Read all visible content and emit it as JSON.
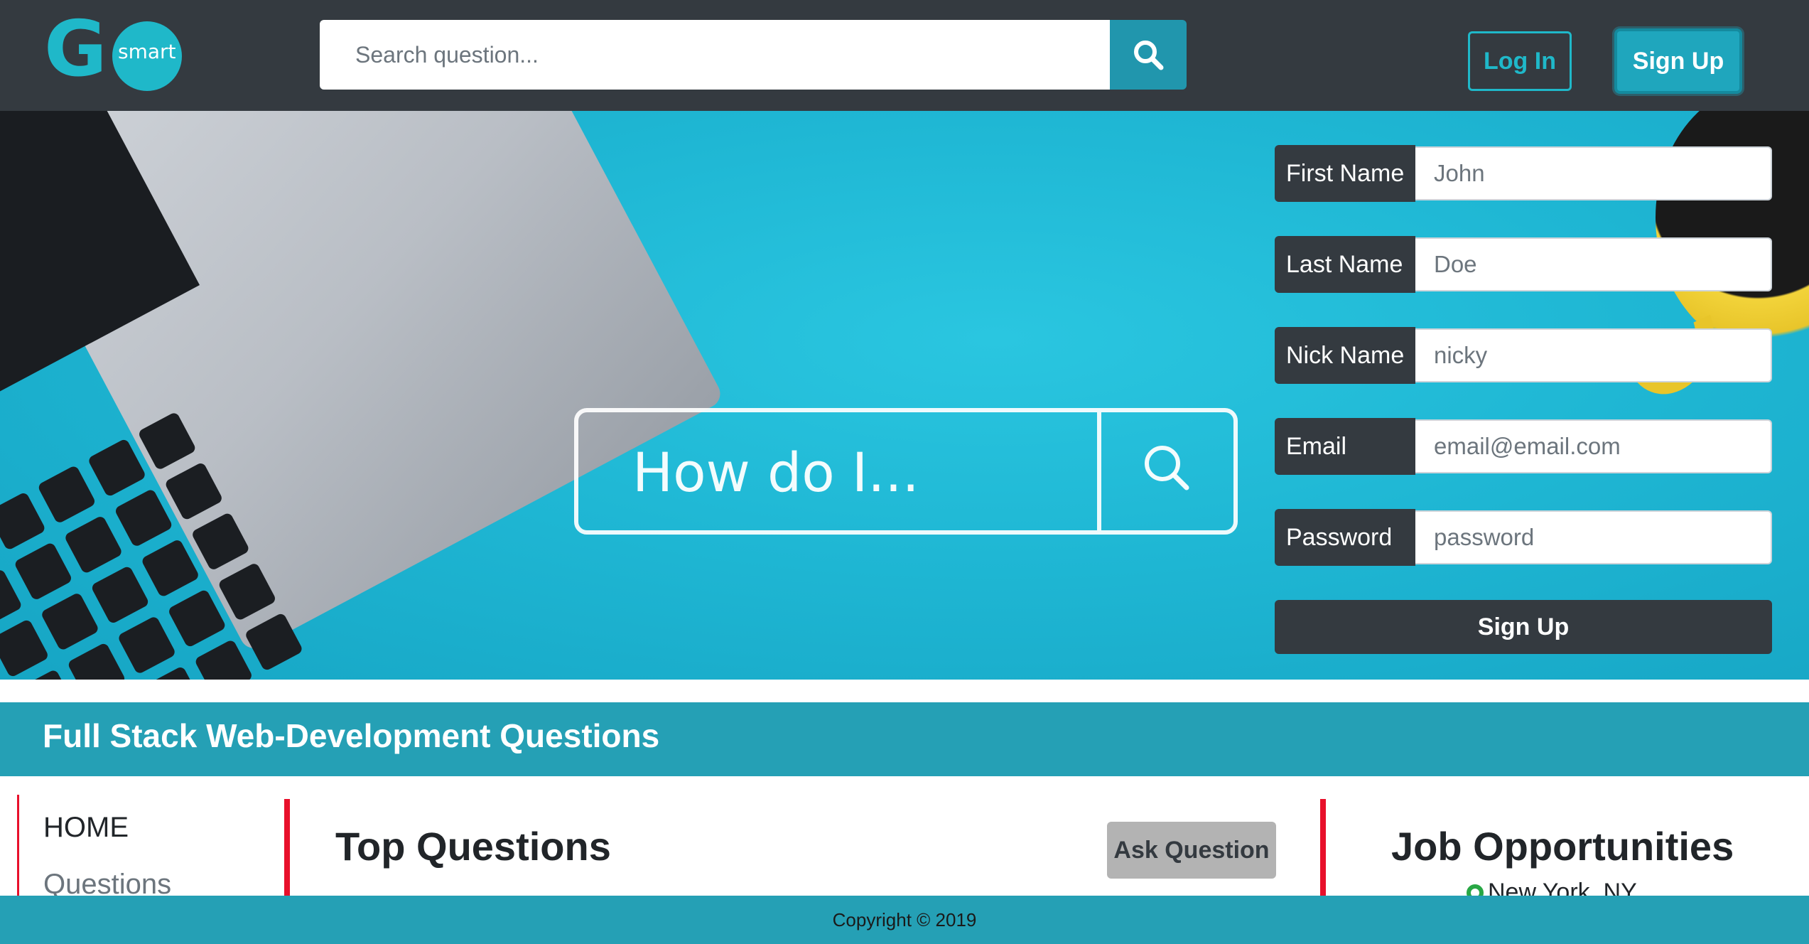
{
  "brand": {
    "logo_big": "G",
    "logo_small": "smart"
  },
  "navbar": {
    "search_placeholder": "Search question...",
    "login_label": "Log In",
    "signup_label": "Sign Up"
  },
  "hero": {
    "search_text": "How do I..."
  },
  "signup_form": {
    "fields": [
      {
        "label": "First Name",
        "placeholder": "John"
      },
      {
        "label": "Last Name",
        "placeholder": "Doe"
      },
      {
        "label": "Nick Name",
        "placeholder": "nicky"
      },
      {
        "label": "Email",
        "placeholder": "email@email.com"
      },
      {
        "label": "Password",
        "placeholder": "password"
      }
    ],
    "submit_label": "Sign Up"
  },
  "section": {
    "title": "Full Stack Web-Development Questions"
  },
  "left_nav": {
    "items": [
      "HOME",
      "Questions"
    ]
  },
  "main": {
    "heading": "Top Questions",
    "ask_label": "Ask Question"
  },
  "jobs": {
    "heading": "Job Opportunities",
    "location": "New York, NY"
  },
  "footer": {
    "copyright": "Copyright © 2019"
  },
  "colors": {
    "navbar_bg": "#343a40",
    "accent": "#1fb8c9",
    "section_bg": "#25a0b5",
    "divider_red": "#e8102b"
  }
}
